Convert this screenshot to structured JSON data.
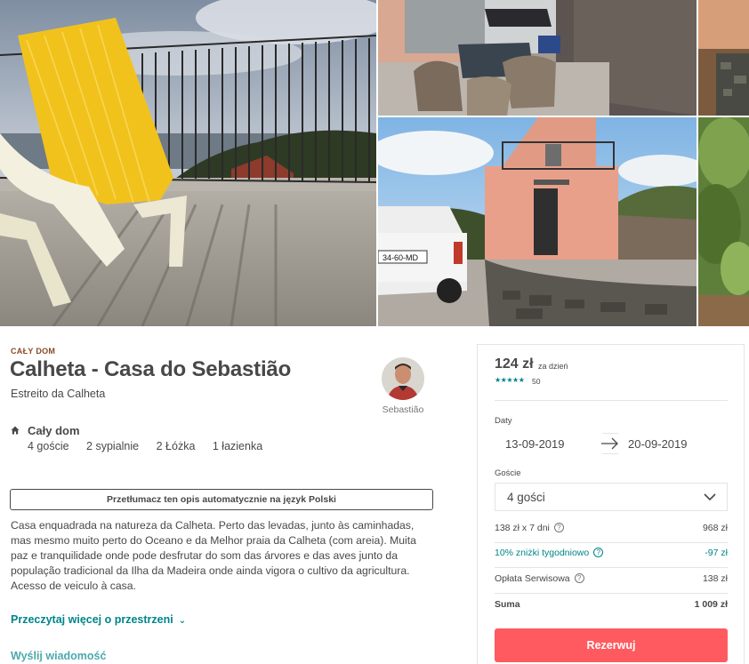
{
  "gallery": {
    "photos": [
      {
        "name": "Balcony with yellow deck chair overlooking the ocean"
      },
      {
        "name": "Patio with table and chairs"
      },
      {
        "name": "Pink house exterior with parked car"
      },
      {
        "name": "Garden stone wall"
      },
      {
        "name": "Green shrubs"
      }
    ]
  },
  "listing": {
    "type_label": "CAŁY DOM",
    "title": "Calheta - Casa do Sebastião",
    "location": "Estreito da Calheta",
    "host_name": "Sebastião",
    "summary": {
      "icon": "home-icon",
      "title": "Cały dom",
      "guests": "4 goście",
      "bedrooms": "2 sypialnie",
      "beds": "2 Łóżka",
      "baths": "1 łazienka"
    },
    "translate_button": "Przetłumacz ten opis automatycznie na język Polski",
    "description": "Casa enquadrada na natureza da Calheta. Perto das levadas, junto às caminhadas, mas mesmo muito perto do Oceano e da Melhor praia da Calheta (com areia). Muita paz e tranquilidade onde pode desfrutar do som das árvores e das aves junto da população tradicional da Ilha da Madeira onde ainda vigora o cultivo da agricultura. Acesso de veiculo à casa.",
    "read_more": "Przeczytaj więcej o przestrzeni",
    "send_message": "Wyślij wiadomość"
  },
  "booking": {
    "price": "124 zł",
    "per_night": "za dzień",
    "stars": "★★★★★",
    "rating": 4.5,
    "review_count": "50",
    "dates_label": "Daty",
    "check_in": "13-09-2019",
    "check_out": "20-09-2019",
    "guests_label": "Goście",
    "guests_value": "4 gości",
    "lines": {
      "nights_label": "138 zł x 7 dni",
      "nights_value": "968 zł",
      "discount_label": "10% zniżki tygodniowo",
      "discount_value": "-97 zł",
      "service_label": "Opłata Serwisowa",
      "service_value": "138 zł",
      "total_label": "Suma",
      "total_value": "1 009 zł"
    },
    "reserve_button": "Rezerwuj"
  },
  "colors": {
    "accent_teal": "#008489",
    "reserve_red": "#ff5a5f",
    "text": "#484848",
    "type_label": "#8a4a26"
  }
}
